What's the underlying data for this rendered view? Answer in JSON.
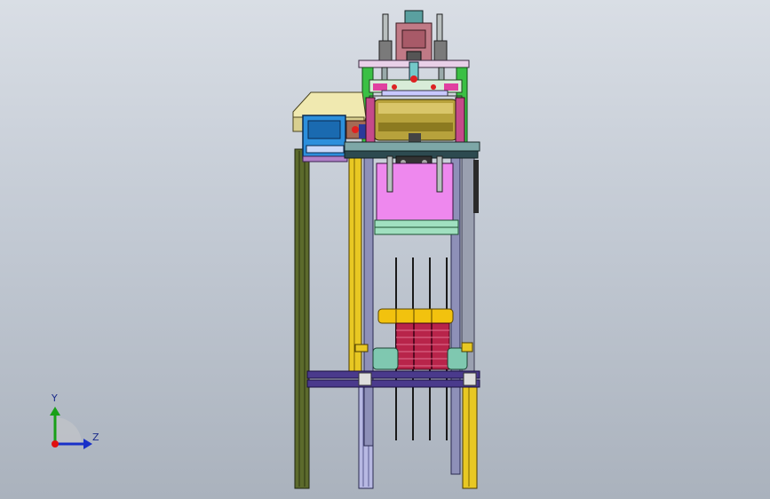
{
  "axes": {
    "y_label": "Y",
    "z_label": "Z",
    "x_color": "#e01010",
    "y_color": "#18a018",
    "z_color": "#1830c8"
  },
  "colors": {
    "background_top": "#d9dee5",
    "background_bottom": "#aab2bd",
    "frame_olive": "#5c6a2c",
    "frame_yellow": "#e8c823",
    "frame_lavender": "#b7b8e2",
    "frame_purple": "#4a3a8c",
    "motor_pink": "#ee88ee",
    "roller_yellow": "#f2c20e",
    "stack_crimson": "#b8244a",
    "cylinder_mauve": "#c07a86",
    "housing_cream": "#f0e9b0",
    "box_blue": "#2c8fdc",
    "guide_green": "#3ac044"
  }
}
